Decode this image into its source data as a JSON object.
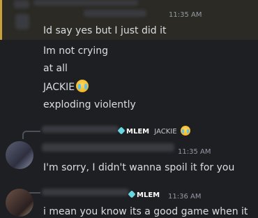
{
  "messages": [
    {
      "timestamp": "11:35 AM",
      "text": "Id say yes but I just did it"
    },
    {
      "text": "Im not crying"
    },
    {
      "text": "at all"
    },
    {
      "text": "JACKIE",
      "emoji": "loudly-crying-face"
    },
    {
      "text": "exploding violently"
    }
  ],
  "reply1": {
    "role": "MLEM",
    "text": "JACKIE",
    "emoji": "loudly-crying-face",
    "timestamp": "11:35 AM",
    "message": "I'm sorry, I didn't wanna spoil it for you"
  },
  "reply2": {
    "role": "MLEM",
    "timestamp": "11:36 AM",
    "message": "i mean you know its a good game when it"
  },
  "colors": {
    "background": "#1e1f22",
    "mention_highlight": "#2b2a25",
    "mention_bar": "#c9a13b",
    "text": "#dbdee1",
    "timestamp": "#949ba4",
    "role_icon": "#67d6e0"
  }
}
